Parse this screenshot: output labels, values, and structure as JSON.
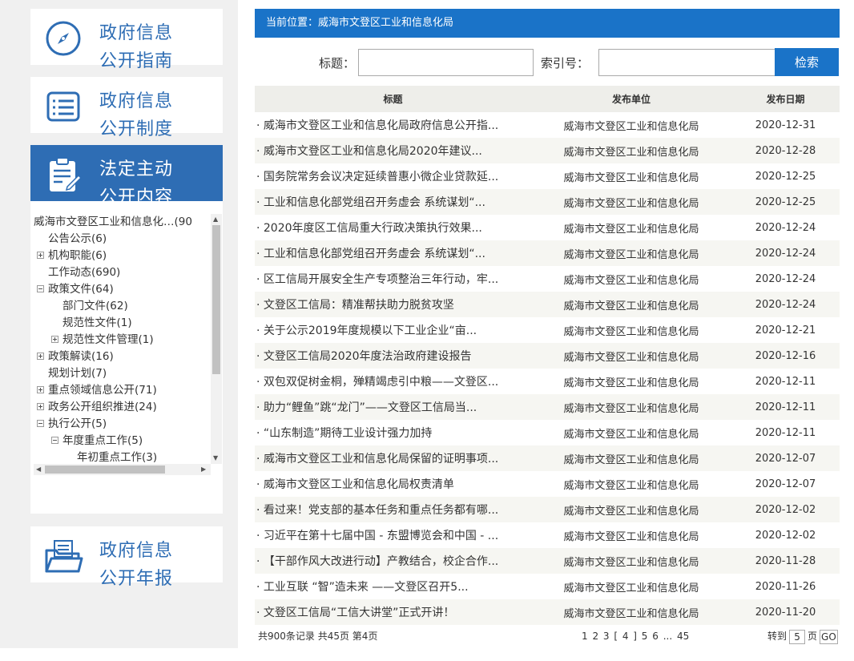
{
  "nav": {
    "guide": {
      "line1": "政府信息",
      "line2": "公开指南",
      "icon": "compass-icon"
    },
    "system": {
      "line1": "政府信息",
      "line2": "公开制度",
      "icon": "list-document-icon"
    },
    "active": {
      "line1": "法定主动",
      "line2": "公开内容",
      "icon": "clipboard-edit-icon"
    },
    "report": {
      "line1": "政府信息",
      "line2": "公开年报",
      "icon": "folder-documents-icon"
    }
  },
  "tree": [
    {
      "label": "威海市文登区工业和信息化…(90",
      "level": 0,
      "toggle": "none"
    },
    {
      "label": "公告公示(6)",
      "level": 1,
      "toggle": "none"
    },
    {
      "label": "机构职能(6)",
      "level": 1,
      "toggle": "plus"
    },
    {
      "label": "工作动态(690)",
      "level": 1,
      "toggle": "none"
    },
    {
      "label": "政策文件(64)",
      "level": 1,
      "toggle": "minus"
    },
    {
      "label": "部门文件(62)",
      "level": 2,
      "toggle": "none"
    },
    {
      "label": "规范性文件(1)",
      "level": 2,
      "toggle": "none"
    },
    {
      "label": "规范性文件管理(1)",
      "level": 2,
      "toggle": "plus"
    },
    {
      "label": "政策解读(16)",
      "level": 1,
      "toggle": "plus"
    },
    {
      "label": "规划计划(7)",
      "level": 1,
      "toggle": "none"
    },
    {
      "label": "重点领域信息公开(71)",
      "level": 1,
      "toggle": "plus"
    },
    {
      "label": "政务公开组织推进(24)",
      "level": 1,
      "toggle": "plus"
    },
    {
      "label": "执行公开(5)",
      "level": 1,
      "toggle": "minus"
    },
    {
      "label": "年度重点工作(5)",
      "level": 2,
      "toggle": "minus"
    },
    {
      "label": "年初重点工作(3)",
      "level": 3,
      "toggle": "none"
    }
  ],
  "breadcrumb": "当前位置：威海市文登区工业和信息化局",
  "search": {
    "title_label": "标题：",
    "index_label": "索引号：",
    "title_value": "",
    "index_value": "",
    "button": "检索"
  },
  "table": {
    "headers": [
      "标题",
      "发布单位",
      "发布日期"
    ],
    "rows": [
      {
        "title": "· 威海市文登区工业和信息化局政府信息公开指...",
        "unit": "威海市文登区工业和信息化局",
        "date": "2020-12-31"
      },
      {
        "title": "· 威海市文登区工业和信息化局2020年建议...",
        "unit": "威海市文登区工业和信息化局",
        "date": "2020-12-28"
      },
      {
        "title": "· 国务院常务会议决定延续普惠小微企业贷款延...",
        "unit": "威海市文登区工业和信息化局",
        "date": "2020-12-25"
      },
      {
        "title": "· 工业和信息化部党组召开务虚会 系统谋划“...",
        "unit": "威海市文登区工业和信息化局",
        "date": "2020-12-25"
      },
      {
        "title": "· 2020年度区工信局重大行政决策执行效果...",
        "unit": "威海市文登区工业和信息化局",
        "date": "2020-12-24"
      },
      {
        "title": "· 工业和信息化部党组召开务虚会 系统谋划“...",
        "unit": "威海市文登区工业和信息化局",
        "date": "2020-12-24"
      },
      {
        "title": "· 区工信局开展安全生产专项整治三年行动，牢...",
        "unit": "威海市文登区工业和信息化局",
        "date": "2020-12-24"
      },
      {
        "title": "· 文登区工信局：精准帮扶助力脱贫攻坚",
        "unit": "威海市文登区工业和信息化局",
        "date": "2020-12-24"
      },
      {
        "title": "· 关于公示2019年度规模以下工业企业“亩...",
        "unit": "威海市文登区工业和信息化局",
        "date": "2020-12-21"
      },
      {
        "title": "· 文登区工信局2020年度法治政府建设报告",
        "unit": "威海市文登区工业和信息化局",
        "date": "2020-12-16"
      },
      {
        "title": "· 双包双促树金桐，殚精竭虑引中粮——文登区...",
        "unit": "威海市文登区工业和信息化局",
        "date": "2020-12-11"
      },
      {
        "title": "· 助力“鲤鱼”跳“龙门”——文登区工信局当...",
        "unit": "威海市文登区工业和信息化局",
        "date": "2020-12-11"
      },
      {
        "title": "· “山东制造”期待工业设计强力加持",
        "unit": "威海市文登区工业和信息化局",
        "date": "2020-12-11"
      },
      {
        "title": "· 威海市文登区工业和信息化局保留的证明事项...",
        "unit": "威海市文登区工业和信息化局",
        "date": "2020-12-07"
      },
      {
        "title": "· 威海市文登区工业和信息化局权责清单",
        "unit": "威海市文登区工业和信息化局",
        "date": "2020-12-07"
      },
      {
        "title": "· 看过来！党支部的基本任务和重点任务都有哪...",
        "unit": "威海市文登区工业和信息化局",
        "date": "2020-12-02"
      },
      {
        "title": "· 习近平在第十七届中国 - 东盟博览会和中国 - ...",
        "unit": "威海市文登区工业和信息化局",
        "date": "2020-12-02"
      },
      {
        "title": "· 【干部作风大改进行动】产教结合，校企合作...",
        "unit": "威海市文登区工业和信息化局",
        "date": "2020-11-28"
      },
      {
        "title": "· 工业互联 “智”造未来 ——文登区召开5...",
        "unit": "威海市文登区工业和信息化局",
        "date": "2020-11-26"
      },
      {
        "title": "· 文登区工信局“工信大讲堂”正式开讲！",
        "unit": "威海市文登区工业和信息化局",
        "date": "2020-11-20"
      }
    ]
  },
  "pager": {
    "summary": "共900条记录 共45页 第4页",
    "pages": "1  2  3  [ 4 ]  5  6  ...  45",
    "goto_label": "转到",
    "goto_value": "5",
    "page_unit": "页",
    "go": "GO"
  },
  "colors": {
    "accent": "#1a73c8",
    "nav_blue": "#2e6db4",
    "header_bg": "#eeeeea"
  }
}
